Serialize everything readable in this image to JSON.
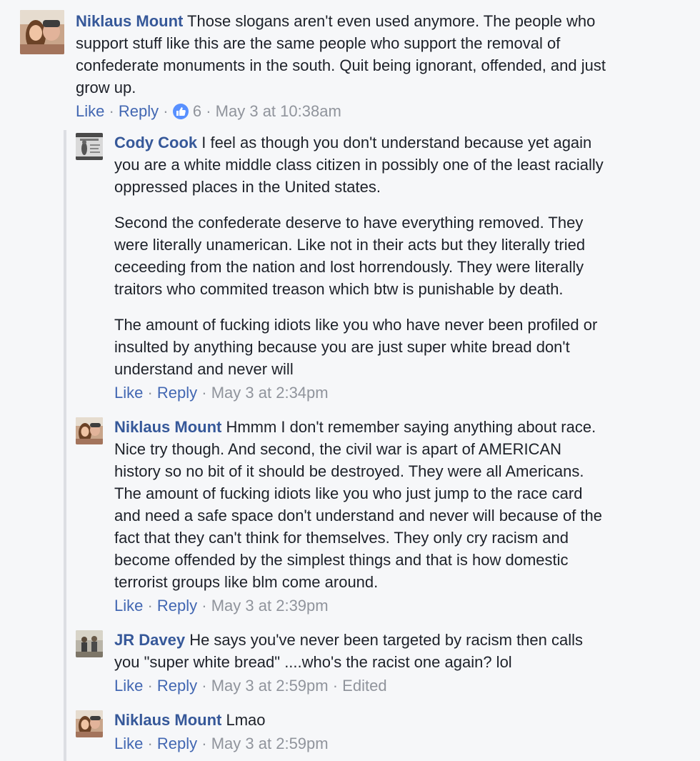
{
  "comments": [
    {
      "author": "Niklaus Mount",
      "text": "Those slogans aren't even used anymore. The people who support stuff like this are the same people who support the removal of confederate monuments in the south. Quit being ignorant, offended, and just grow up.",
      "lines": [
        " Those slogans aren't even used anymore. The people who",
        "support stuff like this are the same people who support the removal of",
        "confederate monuments in the south. Quit being ignorant, offended, and just",
        "grow up."
      ],
      "like_label": "Like",
      "reply_label": "Reply",
      "reaction_count": "6",
      "timestamp": "May 3 at 10:38am"
    }
  ],
  "replies": [
    {
      "author": "Cody Cook",
      "paragraphs": [
        [
          " I feel as though you don't understand because yet again",
          "you are a white middle class citizen in possibly one of the least racially",
          "oppressed places in the United states."
        ],
        [
          "Second the confederate deserve to have everything removed. They",
          "were literally unamerican. Like not in their acts but they literally tried",
          "ceceeding from the nation and lost horrendously. They were literally",
          "traitors who commited treason which btw is punishable by death."
        ],
        [
          "The amount of fucking idiots like you who have never been profiled or",
          "insulted by anything because you are just super white bread don't",
          "understand and never will"
        ]
      ],
      "like_label": "Like",
      "reply_label": "Reply",
      "timestamp": "May 3 at 2:34pm"
    },
    {
      "author": "Niklaus Mount",
      "paragraphs": [
        [
          " Hmmm I don't remember saying anything about race.",
          "Nice try though. And second, the civil war is apart of AMERICAN",
          "history so no bit of it should be destroyed. They were all Americans.",
          "The amount of fucking idiots like you who just jump to the race card",
          "and need a safe space don't understand and never will because of the",
          "fact that they can't think for themselves. They only cry racism and",
          "become offended by the simplest things and that is how domestic",
          "terrorist groups like blm come around."
        ]
      ],
      "like_label": "Like",
      "reply_label": "Reply",
      "timestamp": "May 3 at 2:39pm"
    },
    {
      "author": "JR Davey",
      "paragraphs": [
        [
          " He says you've never been targeted by racism then calls",
          "you \"super white bread\" ....who's the racist one again? lol"
        ]
      ],
      "like_label": "Like",
      "reply_label": "Reply",
      "timestamp": "May 3 at 2:59pm",
      "edited_label": "Edited"
    },
    {
      "author": "Niklaus Mount",
      "paragraphs": [
        [
          " Lmao"
        ]
      ],
      "like_label": "Like",
      "reply_label": "Reply",
      "timestamp": "May 3 at 2:59pm"
    }
  ],
  "colors": {
    "background": "#f6f7f9",
    "author": "#365899",
    "link": "#4267b2",
    "meta": "#90949c",
    "like_badge": "#5890ff",
    "thread_bar": "#dcdee3"
  },
  "icons": {
    "reaction": "thumbs-up-icon",
    "avatar_niklaus": "avatar-photo",
    "avatar_cody": "avatar-photo",
    "avatar_jr": "avatar-photo"
  }
}
